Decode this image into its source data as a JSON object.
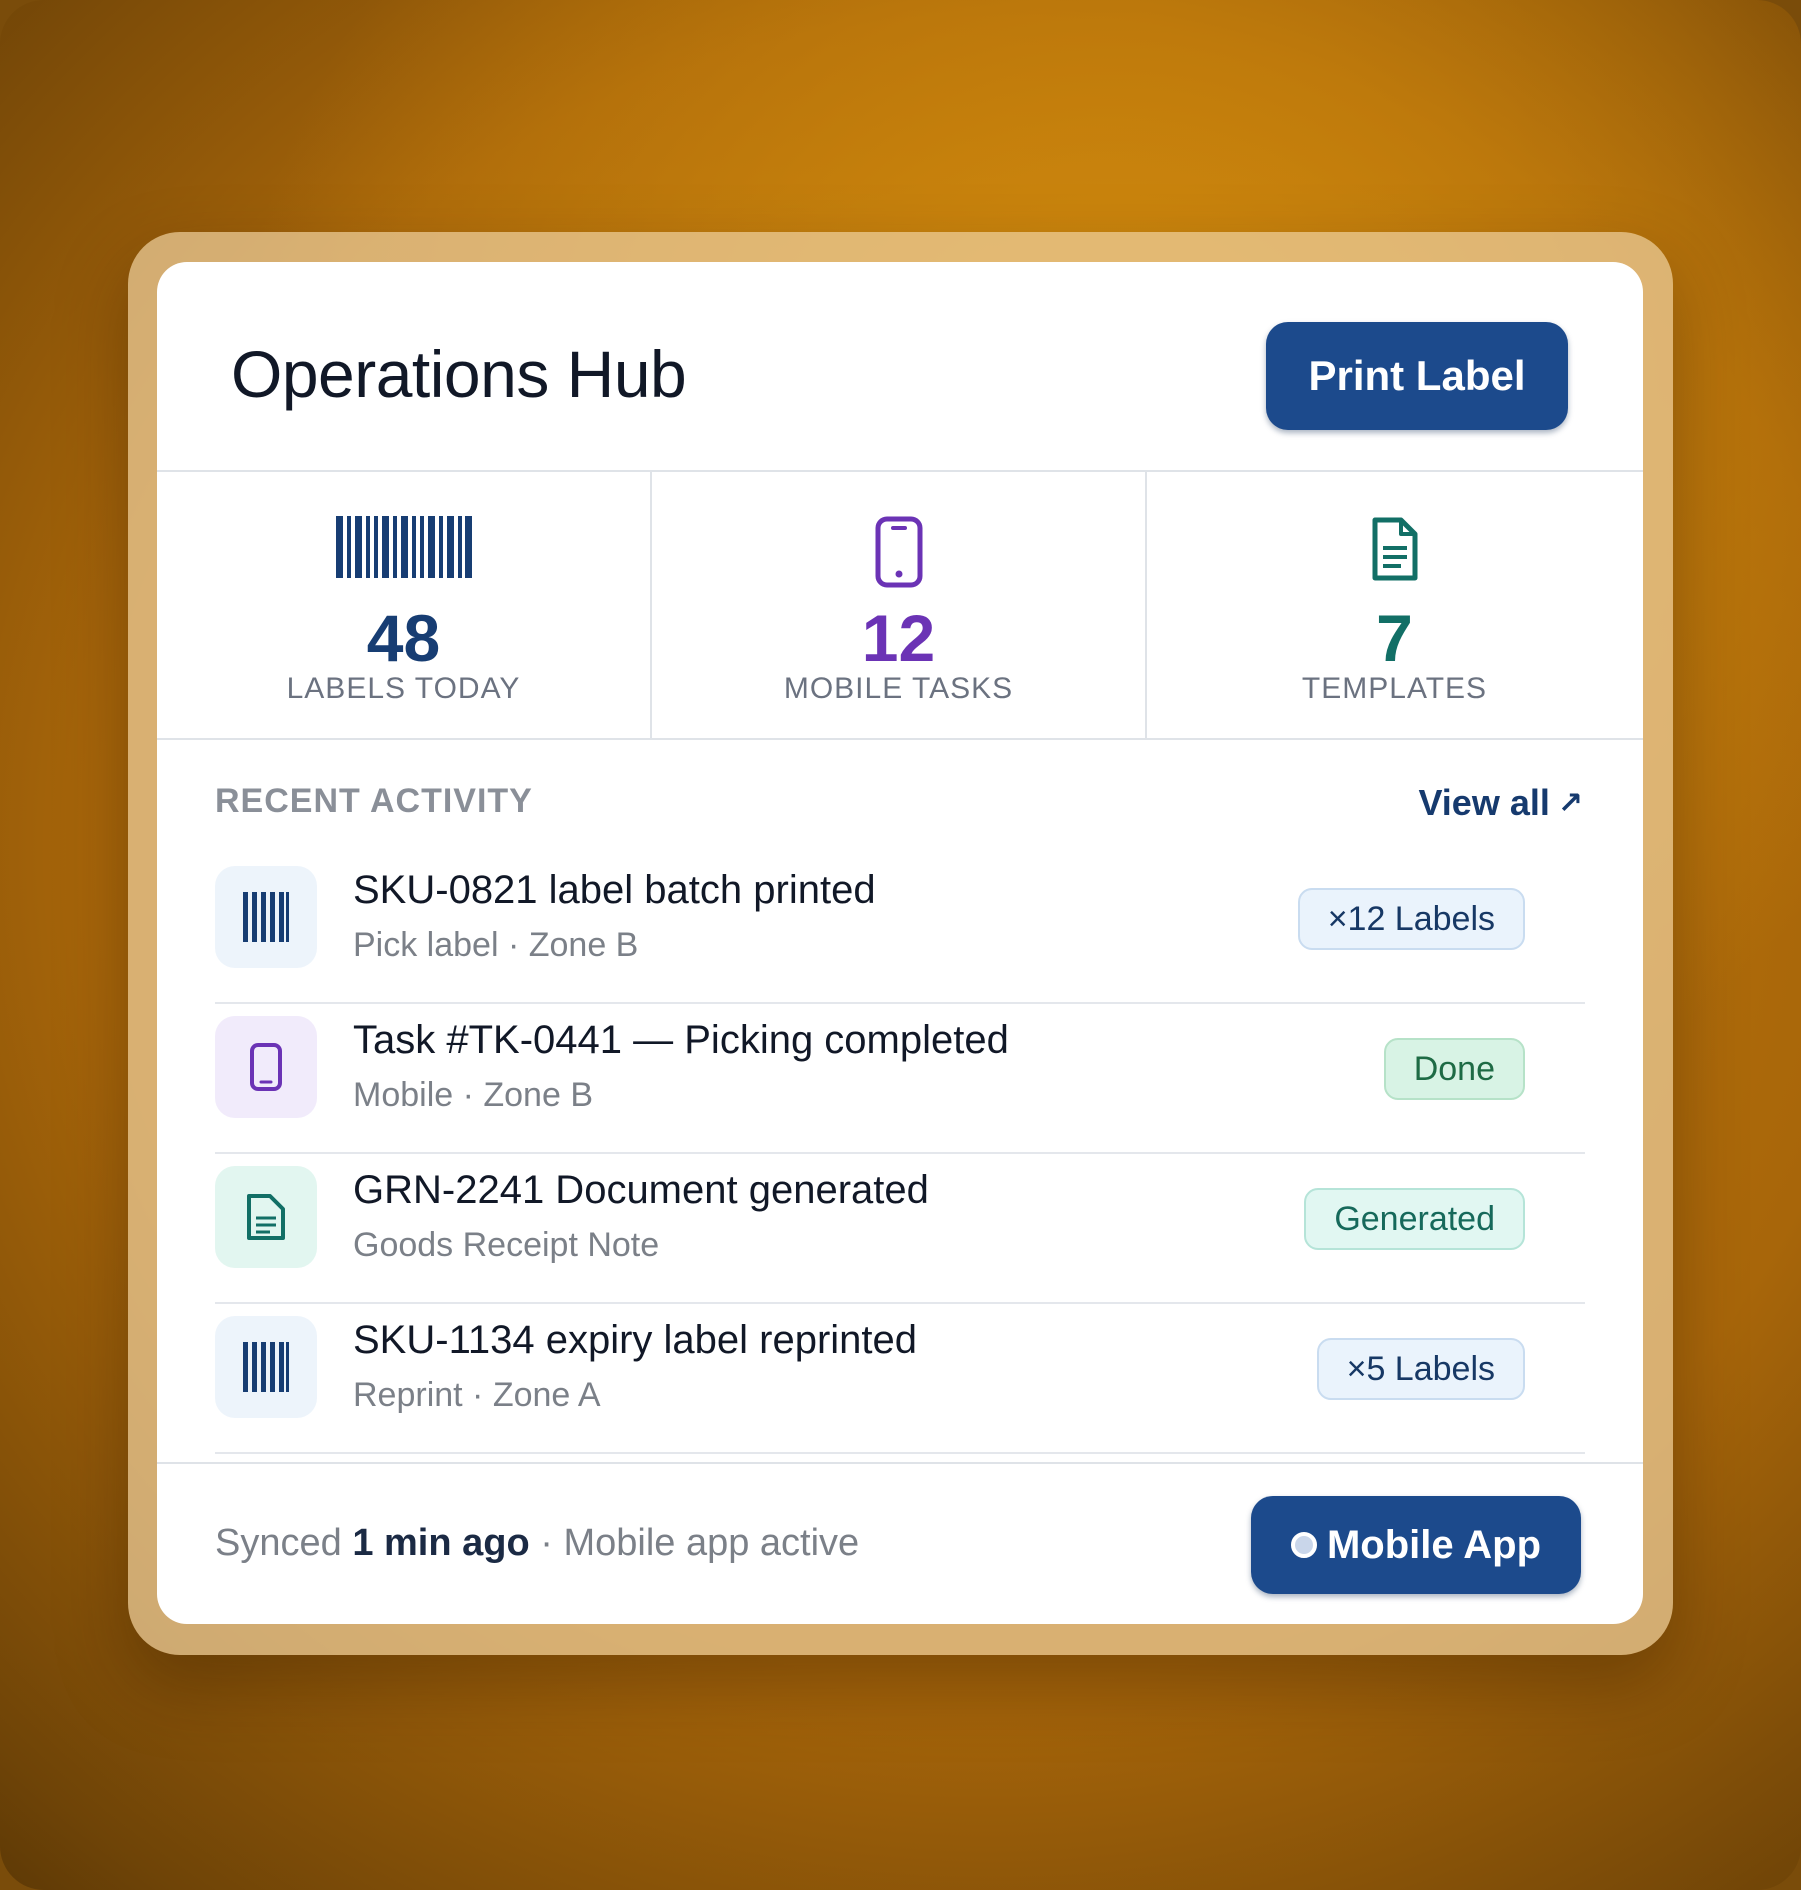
{
  "header": {
    "title": "Operations Hub",
    "print_button": "Print Label"
  },
  "stats": [
    {
      "icon": "barcode-icon",
      "value": "48",
      "label": "LABELS TODAY",
      "color": "#173d73"
    },
    {
      "icon": "mobile-phone-icon",
      "value": "12",
      "label": "MOBILE TASKS",
      "color": "#6b33b5"
    },
    {
      "icon": "document-icon",
      "value": "7",
      "label": "TEMPLATES",
      "color": "#126f66"
    }
  ],
  "activity": {
    "heading": "RECENT ACTIVITY",
    "view_all": "View all",
    "view_all_arrow": "↗",
    "items": [
      {
        "icon": "barcode-icon",
        "title": "SKU-0821 label batch printed",
        "subtitle": "Pick label · Zone B",
        "badge": "×12 Labels",
        "badge_style": "blue"
      },
      {
        "icon": "mobile-phone-icon",
        "title": "Task #TK-0441 — Picking completed",
        "subtitle": "Mobile · Zone B",
        "badge": "Done",
        "badge_style": "green"
      },
      {
        "icon": "document-icon",
        "title": "GRN-2241 Document generated",
        "subtitle": "Goods Receipt Note",
        "badge": "Generated",
        "badge_style": "teal"
      },
      {
        "icon": "barcode-icon",
        "title": "SKU-1134 expiry label reprinted",
        "subtitle": "Reprint · Zone A",
        "badge": "×5 Labels",
        "badge_style": "blue"
      }
    ]
  },
  "footer": {
    "synced_prefix": "Synced",
    "synced_time": "1 min ago",
    "separator": "·",
    "status": "Mobile app active",
    "mobile_button": "Mobile App"
  },
  "colors": {
    "primary": "#1c4a8c",
    "background_amber": "#c47d0c"
  }
}
